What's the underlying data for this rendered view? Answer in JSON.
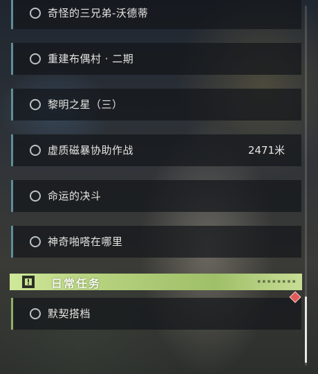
{
  "quests": [
    {
      "title": "奇怪的三兄弟-沃德蒂",
      "distance": ""
    },
    {
      "title": "重建布偶村 · 二期",
      "distance": ""
    },
    {
      "title": "黎明之星（三）",
      "distance": ""
    },
    {
      "title": "虚质磁暴协助作战",
      "distance": "2471米"
    },
    {
      "title": "命运的决斗",
      "distance": ""
    },
    {
      "title": "神奇啪嗒在哪里",
      "distance": ""
    }
  ],
  "daily_category": {
    "title": "日常任务",
    "icon": "exclamation-icon",
    "icon_glyph": "!",
    "code_text": "■ ■ ■ ■ ■ ■ ■ ■"
  },
  "daily_quests": [
    {
      "title": "默契搭档"
    }
  ],
  "colors": {
    "quest_accent": "#5e8f9a",
    "daily_accent": "#8fb06a",
    "daily_header": "#b6d27e",
    "marker": "#e05a5a"
  }
}
